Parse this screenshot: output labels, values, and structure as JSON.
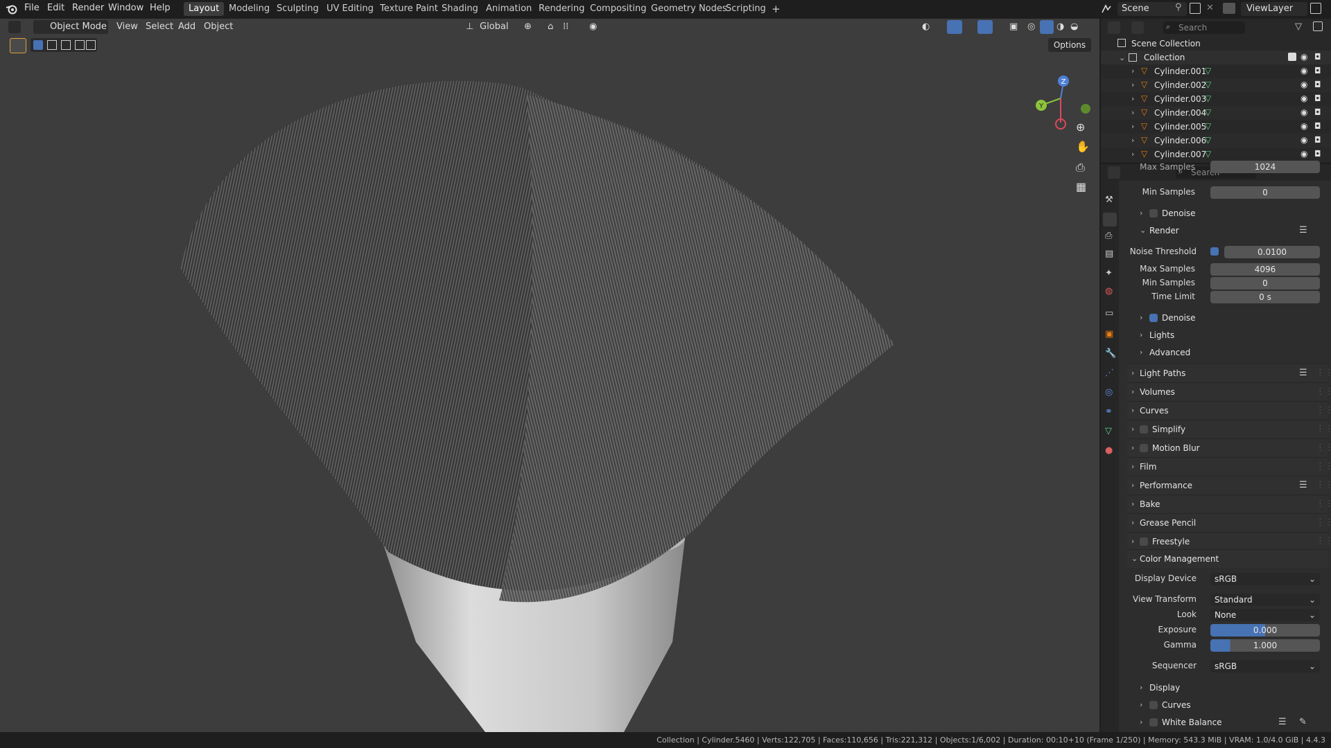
{
  "topbar": {
    "menus": [
      "File",
      "Edit",
      "Render",
      "Window",
      "Help"
    ],
    "workspaces": [
      "Layout",
      "Modeling",
      "Sculpting",
      "UV Editing",
      "Texture Paint",
      "Shading",
      "Animation",
      "Rendering",
      "Compositing",
      "Geometry Nodes",
      "Scripting"
    ],
    "active_workspace": "Layout",
    "add_tab": "+",
    "scene": "Scene",
    "view_layer": "ViewLayer"
  },
  "viewport": {
    "mode": "Object Mode",
    "menus": [
      "View",
      "Select",
      "Add",
      "Object"
    ],
    "orientation": "Global",
    "options": "Options",
    "gizmo": {
      "z": "Z",
      "y": "Y"
    }
  },
  "outliner": {
    "search_placeholder": "Search",
    "scene_collection": "Scene Collection",
    "collection": "Collection",
    "objects": [
      "Cylinder.001",
      "Cylinder.002",
      "Cylinder.003",
      "Cylinder.004",
      "Cylinder.005",
      "Cylinder.006",
      "Cylinder.007"
    ]
  },
  "properties": {
    "search_placeholder": "Search",
    "top_partial": {
      "max_samples_label": "Max Samples",
      "max_samples_value": "1024",
      "min_samples_label": "Min Samples",
      "min_samples_value": "0"
    },
    "denoise1": "Denoise",
    "render_section": "Render",
    "noise_threshold_label": "Noise Threshold",
    "noise_threshold_value": "0.0100",
    "max_samples_label": "Max Samples",
    "max_samples_value": "4096",
    "min_samples_label": "Min Samples",
    "min_samples_value": "0",
    "time_limit_label": "Time Limit",
    "time_limit_value": "0 s",
    "denoise2": "Denoise",
    "lights": "Lights",
    "advanced": "Advanced",
    "panels": [
      "Light Paths",
      "Volumes",
      "Curves",
      "Simplify",
      "Motion Blur",
      "Film",
      "Performance",
      "Bake",
      "Grease Pencil",
      "Freestyle"
    ],
    "color_management": "Color Management",
    "display_device_label": "Display Device",
    "display_device_value": "sRGB",
    "view_transform_label": "View Transform",
    "view_transform_value": "Standard",
    "look_label": "Look",
    "look_value": "None",
    "exposure_label": "Exposure",
    "exposure_value": "0.000",
    "gamma_label": "Gamma",
    "gamma_value": "1.000",
    "sequencer_label": "Sequencer",
    "sequencer_value": "sRGB",
    "cm_sub": [
      "Display",
      "Curves",
      "White Balance"
    ]
  },
  "status": {
    "text": "Collection | Cylinder.5460 | Verts:122,705 | Faces:110,656 | Tris:221,312 | Objects:1/6,002 | Duration: 00:10+10 (Frame 1/250) | Memory: 543.3 MiB | VRAM: 1.0/4.0 GiB | 4.4.3"
  },
  "colors": {
    "accent": "#4772b3",
    "mesh_icon": "#e87d0d",
    "data_icon": "#5fd28a",
    "viewport_bg": "#3d3d3d"
  }
}
